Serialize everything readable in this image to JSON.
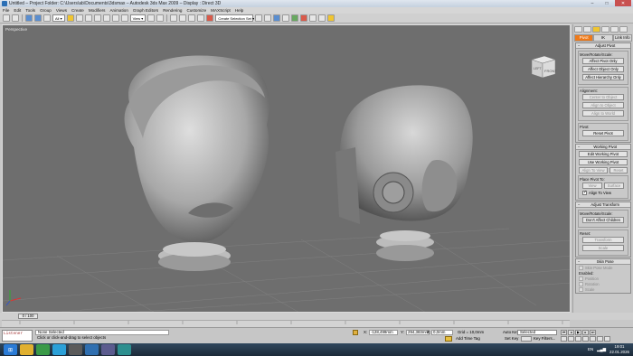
{
  "titlebar": {
    "title": "Untitled    – Project Folder: C:\\Users\\ab\\Documents\\3dsmax    –    Autodesk 3ds Max 2009    –    Display : Direct 3D",
    "min": "–",
    "max": "□",
    "close": "✕"
  },
  "menu": [
    "File",
    "Edit",
    "Tools",
    "Group",
    "Views",
    "Create",
    "Modifiers",
    "Animation",
    "Graph Editors",
    "Rendering",
    "Customize",
    "MAXScript",
    "Help"
  ],
  "toolbar": {
    "filter_value": "All",
    "view_value": "View",
    "selection_set_placeholder": "Create Selection Set"
  },
  "viewport": {
    "label": "Perspective",
    "viewcube_label": "FRONT",
    "viewcube_side": "LEFT"
  },
  "command_panel": {
    "tabs": [
      "Pivot",
      "IK",
      "Link Info"
    ],
    "adjust_pivot": {
      "title": "Adjust Pivot",
      "move_group": "Move/Rotate/Scale:",
      "buttons": [
        "Affect Pivot Only",
        "Affect Object Only",
        "Affect Hierarchy Only"
      ],
      "alignment_group": "Alignment:",
      "align_buttons": [
        "Center to Object",
        "Align to Object",
        "Align to World"
      ],
      "pivot_group": "Pivot:",
      "reset_pivot": "Reset Pivot"
    },
    "working_pivot": {
      "title": "Working Pivot",
      "edit": "Edit Working Pivot",
      "use": "Use Working Pivot",
      "align_to_view": "Align To View",
      "reset": "Reset",
      "place_label": "Place Pivot To:",
      "view": "View",
      "surface": "Surface",
      "align_chk": "Align To View"
    },
    "adjust_transform": {
      "title": "Adjust Transform",
      "move_group": "Move/Rotate/Scale:",
      "dont_affect": "Don't Affect Children",
      "reset_group": "Reset:",
      "transform": "Transform",
      "scale": "Scale"
    },
    "skin_pose": {
      "title": "Skin Pose",
      "mode": "Skin Pose Mode",
      "enabled": "Enabled:",
      "position": "Position",
      "rotation": "Rotation",
      "scale": "Scale"
    }
  },
  "timeline": {
    "frame_display": "0 / 100"
  },
  "status": {
    "maxscript_label": "Listener",
    "selection": "None Selected",
    "prompt": "Click or click-and-drag to select objects",
    "x_label": "X:",
    "x_value": "-128,499mm",
    "y_label": "Y:",
    "y_value": "294,383mm",
    "z_label": "Z:",
    "z_value": "0,0mm",
    "grid": "Grid = 10,0mm",
    "add_time_tag": "Add Time Tag",
    "auto_key": "Auto Key",
    "set_key": "Set Key",
    "key_filters": "Key Filters...",
    "selected_option": "Selected"
  },
  "taskbar": {
    "lang": "EN",
    "time": "19:01",
    "date": "22.01.2026"
  },
  "colors": {
    "viewport_bg": "#6e6e6e",
    "accent_tab": "#ee7a1a"
  }
}
